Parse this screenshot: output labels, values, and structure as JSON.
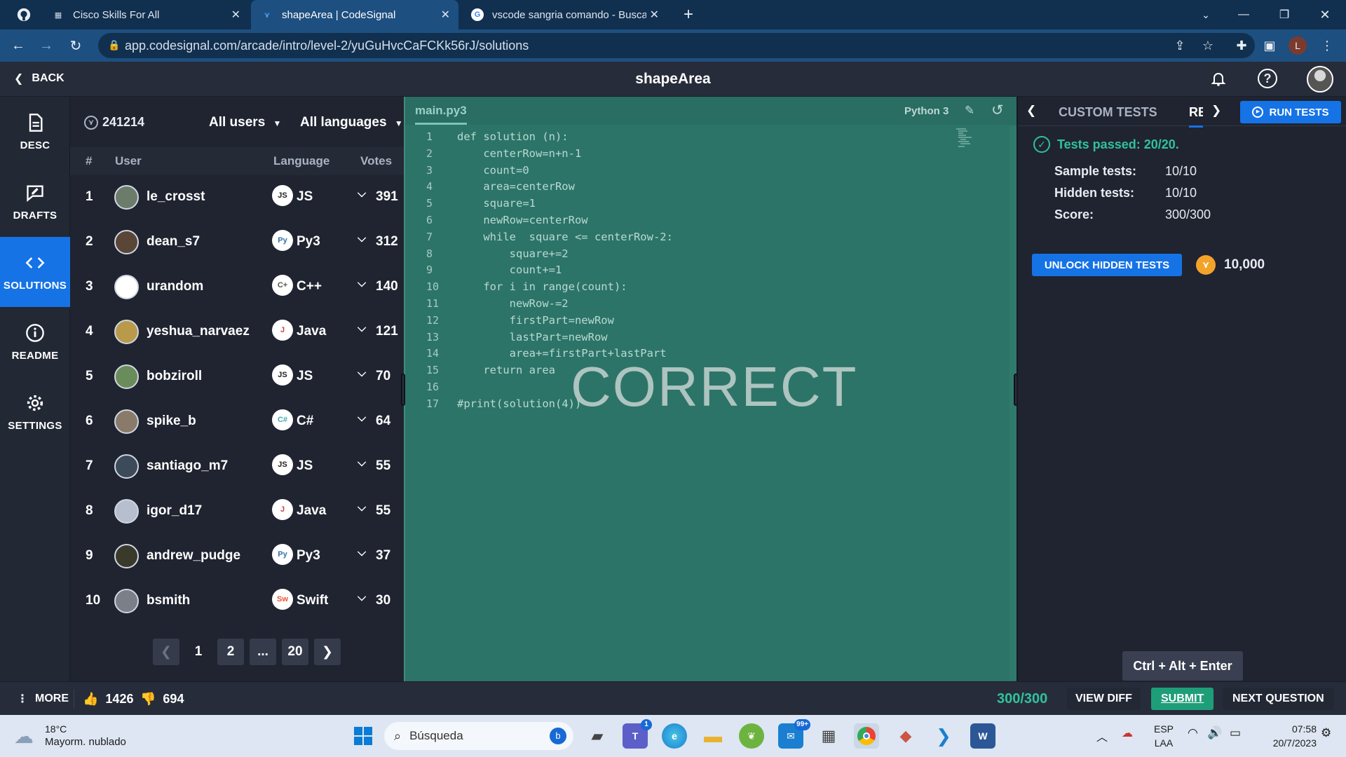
{
  "browser": {
    "tabs": [
      {
        "title": "Cisco Skills For All",
        "active": false
      },
      {
        "title": "shapeArea | CodeSignal",
        "active": true
      },
      {
        "title": "vscode sangria comando - Busca",
        "active": false
      }
    ],
    "url": "app.codesignal.com/arcade/intro/level-2/yuGuHvcCaFCKk56rJ/solutions",
    "profile_initial": "L"
  },
  "app": {
    "back_label": "BACK",
    "title": "shapeArea"
  },
  "sidebar": {
    "items": [
      {
        "label": "DESC",
        "icon": "document-icon",
        "active": false
      },
      {
        "label": "DRAFTS",
        "icon": "drafts-icon",
        "active": false
      },
      {
        "label": "SOLUTIONS",
        "icon": "code-icon",
        "active": true
      },
      {
        "label": "README",
        "icon": "info-icon",
        "active": false
      },
      {
        "label": "SETTINGS",
        "icon": "gear-icon",
        "active": false
      }
    ]
  },
  "solutions": {
    "total": "241214",
    "users_filter": "All users",
    "languages_filter": "All languages",
    "columns": {
      "rank": "#",
      "user": "User",
      "language": "Language",
      "votes": "Votes"
    },
    "rows": [
      {
        "rank": "1",
        "user": "le_crosst",
        "lang_badge": "JS",
        "language": "JS",
        "votes": "391"
      },
      {
        "rank": "2",
        "user": "dean_s7",
        "lang_badge": "Py",
        "language": "Py3",
        "votes": "312"
      },
      {
        "rank": "3",
        "user": "urandom",
        "lang_badge": "C+",
        "language": "C++",
        "votes": "140"
      },
      {
        "rank": "4",
        "user": "yeshua_narvaez",
        "lang_badge": "J",
        "language": "Java",
        "votes": "121"
      },
      {
        "rank": "5",
        "user": "bobziroll",
        "lang_badge": "JS",
        "language": "JS",
        "votes": "70"
      },
      {
        "rank": "6",
        "user": "spike_b",
        "lang_badge": "C#",
        "language": "C#",
        "votes": "64"
      },
      {
        "rank": "7",
        "user": "santiago_m7",
        "lang_badge": "JS",
        "language": "JS",
        "votes": "55"
      },
      {
        "rank": "8",
        "user": "igor_d17",
        "lang_badge": "J",
        "language": "Java",
        "votes": "55"
      },
      {
        "rank": "9",
        "user": "andrew_pudge",
        "lang_badge": "Py",
        "language": "Py3",
        "votes": "37"
      },
      {
        "rank": "10",
        "user": "bsmith",
        "lang_badge": "Sw",
        "language": "Swift",
        "votes": "30"
      }
    ],
    "pager": {
      "pages": [
        "1",
        "2",
        "...",
        "20"
      ]
    }
  },
  "editor": {
    "filename": "main.py3",
    "language": "Python 3",
    "overlay": "CORRECT",
    "lines": [
      "def solution (n):",
      "    centerRow=n+n-1",
      "    count=0",
      "    area=centerRow",
      "    square=1",
      "    newRow=centerRow",
      "    while  square <= centerRow-2:",
      "        square+=2",
      "        count+=1",
      "    for i in range(count):",
      "        newRow-=2",
      "        firstPart=newRow",
      "        lastPart=newRow",
      "        area+=firstPart+lastPart",
      "    return area",
      "",
      "#print(solution(4))"
    ]
  },
  "tests": {
    "tabs": [
      "CUSTOM TESTS",
      "RE"
    ],
    "run_label": "RUN TESTS",
    "passed": "Tests passed: 20/20.",
    "sample_label": "Sample tests:",
    "sample_value": "10/10",
    "hidden_label": "Hidden tests:",
    "hidden_value": "10/10",
    "score_label": "Score:",
    "score_value": "300/300",
    "unlock_label": "UNLOCK HIDDEN TESTS",
    "coins": "10,000",
    "tooltip": "Ctrl + Alt + Enter"
  },
  "footer": {
    "more": "MORE",
    "likes": "1426",
    "dislikes": "694",
    "score": "300/300",
    "view_diff": "VIEW DIFF",
    "submit": "SUBMIT",
    "next": "NEXT QUESTION"
  },
  "taskbar": {
    "weather_temp": "18°C",
    "weather_desc": "Mayorm. nublado",
    "search_placeholder": "Búsqueda",
    "teams_badge": "1",
    "mail_badge": "99+",
    "lang_line1": "ESP",
    "lang_line2": "LAA",
    "time": "07:58",
    "date": "20/7/2023"
  },
  "colors": {
    "accent": "#1673e6",
    "success": "#30c29b",
    "editor_bg": "#2c7467"
  }
}
